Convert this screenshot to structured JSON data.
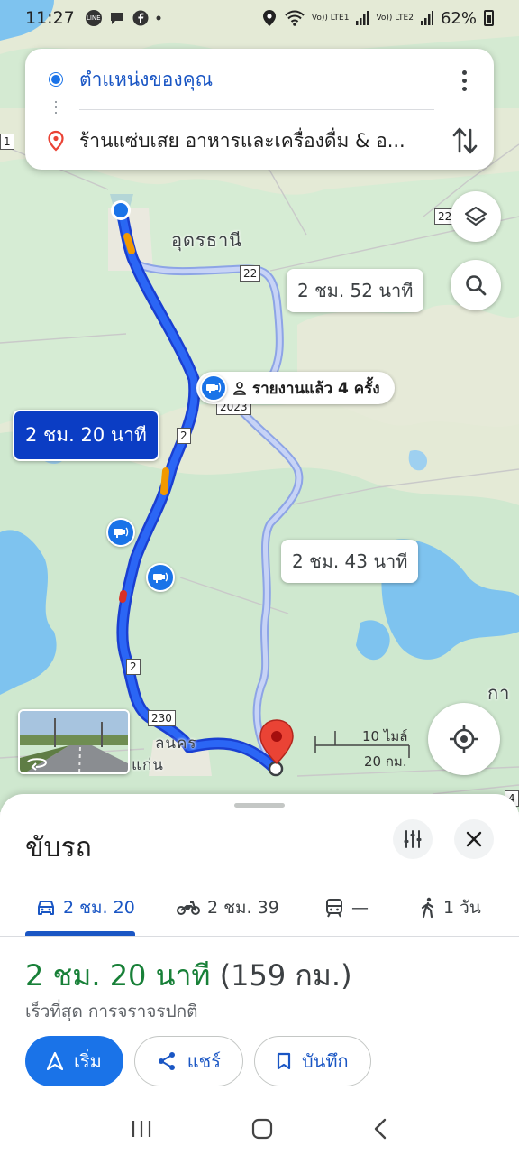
{
  "status_bar": {
    "time": "11:27",
    "notif_line": "LINE",
    "signal_1": "Vo)) LTE1",
    "signal_2": "Vo)) LTE2",
    "battery": "62%"
  },
  "route_card": {
    "origin": "ตำแหน่งของคุณ",
    "destination": "ร้านแซ่บเสย อาหารและเครื่องดื่ม & อ..."
  },
  "map": {
    "city_label": "อุดรธานี",
    "partial_label_right": "กา",
    "town_label_1": "ลนคร",
    "town_label_2": "แก่น",
    "road_22_a": "22",
    "road_22_b": "22",
    "road_2_a": "2",
    "road_2_b": "2",
    "road_2023": "2023",
    "road_230": "230",
    "road_1": "1",
    "road_4": "4",
    "alt_route_1_duration": "2 ชม. 52 นาที",
    "alt_route_2_duration": "2 ชม. 43 นาที",
    "selected_route_duration": "2 ชม. 20 นาที",
    "report_text": "รายงานแล้ว 4 ครั้ง",
    "scale_miles": "10 ไมล์",
    "scale_km": "20 กม.",
    "colors": {
      "route_primary": "#1a56e8",
      "route_alt": "#aab9ee",
      "destination_pin": "#ea4335"
    }
  },
  "sheet": {
    "mode_title": "ขับรถ",
    "tabs": [
      {
        "icon": "car-icon",
        "label": "2 ชม. 20",
        "active": true
      },
      {
        "icon": "motorcycle-icon",
        "label": "2 ชม. 39",
        "active": false
      },
      {
        "icon": "transit-icon",
        "label": "—",
        "active": false
      },
      {
        "icon": "walk-icon",
        "label": "1 วัน",
        "active": false
      }
    ],
    "summary_duration": "2 ชม. 20 นาที",
    "summary_distance": "(159 กม.)",
    "summary_sub": "เร็วที่สุด การจราจรปกติ",
    "buttons": {
      "start": "เริ่ม",
      "share": "แชร์",
      "save": "บันทึก"
    }
  }
}
